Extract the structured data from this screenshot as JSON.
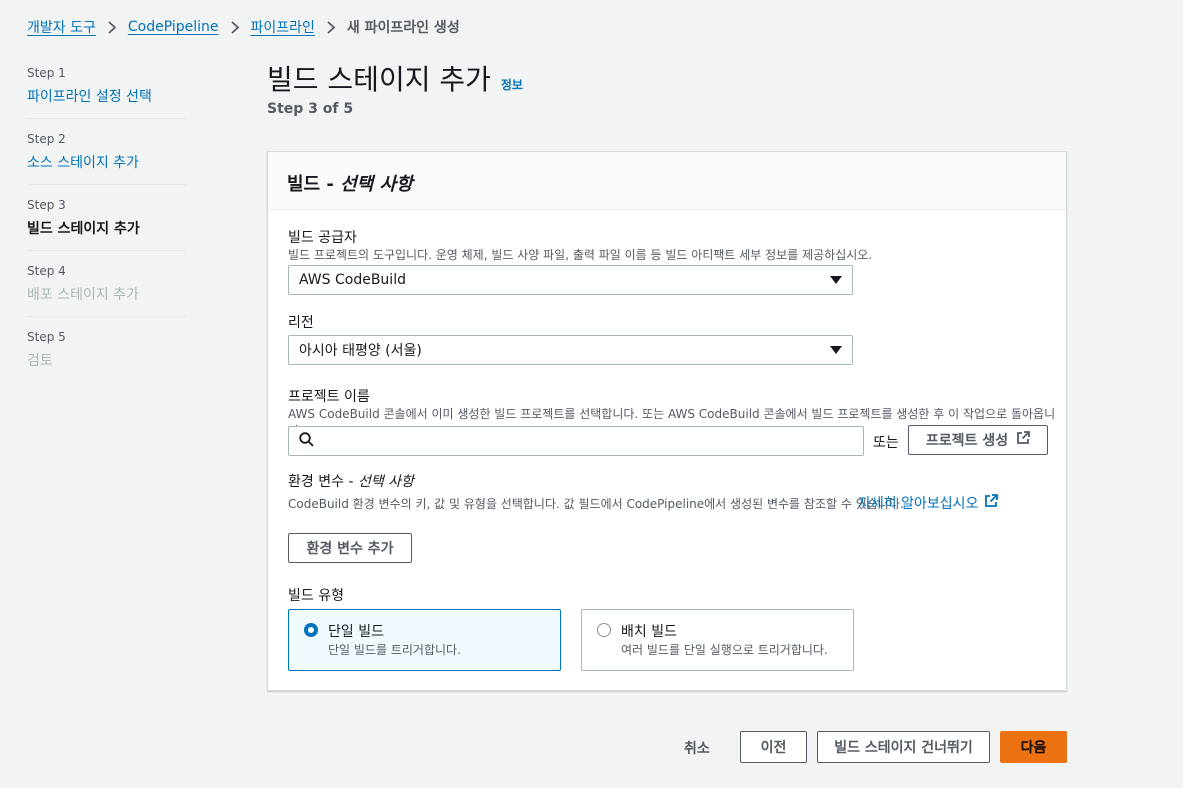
{
  "breadcrumb": {
    "items": [
      "개발자 도구",
      "CodePipeline",
      "파이프라인"
    ],
    "current": "새 파이프라인 생성"
  },
  "steps": [
    {
      "num": "Step 1",
      "label": "파이프라인 설정 선택",
      "state": "done"
    },
    {
      "num": "Step 2",
      "label": "소스 스테이지 추가",
      "state": "done"
    },
    {
      "num": "Step 3",
      "label": "빌드 스테이지 추가",
      "state": "active"
    },
    {
      "num": "Step 4",
      "label": "배포 스테이지 추가",
      "state": "disabled"
    },
    {
      "num": "Step 5",
      "label": "검토",
      "state": "disabled"
    }
  ],
  "header": {
    "title": "빌드 스테이지 추가",
    "info": "정보",
    "step_of": "Step 3 of 5"
  },
  "panel": {
    "title_main": "빌드 - ",
    "title_optional": "선택 사항",
    "provider": {
      "label": "빌드 공급자",
      "desc": "빌드 프로젝트의 도구입니다. 운영 체제, 빌드 사양 파일, 출력 파일 이름 등 빌드 아티팩트 세부 정보를 제공하십시오.",
      "value": "AWS CodeBuild"
    },
    "region": {
      "label": "리전",
      "value": "아시아 태평양 (서울)"
    },
    "project": {
      "label": "프로젝트 이름",
      "desc": "AWS CodeBuild 콘솔에서 이미 생성한 빌드 프로젝트를 선택합니다. 또는 AWS CodeBuild 콘솔에서 빌드 프로젝트를 생성한 후 이 작업으로 돌아옵니다.",
      "search_value": "",
      "or": "또는",
      "create_button": "프로젝트 생성"
    },
    "env": {
      "label_main": "환경 변수 - ",
      "label_optional": "선택 사항",
      "desc": "CodeBuild 환경 변수의 키, 값 및 유형을 선택합니다. 값 필드에서 CodePipeline에서 생성된 변수를 참조할 수 있습니다.",
      "learn_more": "자세히 알아보십시오",
      "add_button": "환경 변수 추가"
    },
    "build_type": {
      "label": "빌드 유형",
      "options": [
        {
          "title": "단일 빌드",
          "desc": "단일 빌드를 트리거합니다.",
          "selected": true
        },
        {
          "title": "배치 빌드",
          "desc": "여러 빌드를 단일 실행으로 트리거합니다.",
          "selected": false
        }
      ]
    }
  },
  "footer": {
    "cancel": "취소",
    "previous": "이전",
    "skip": "빌드 스테이지 건너뛰기",
    "next": "다음"
  },
  "colors": {
    "link": "#0073bb",
    "primary": "#ec7211",
    "background": "#f2f3f3"
  }
}
